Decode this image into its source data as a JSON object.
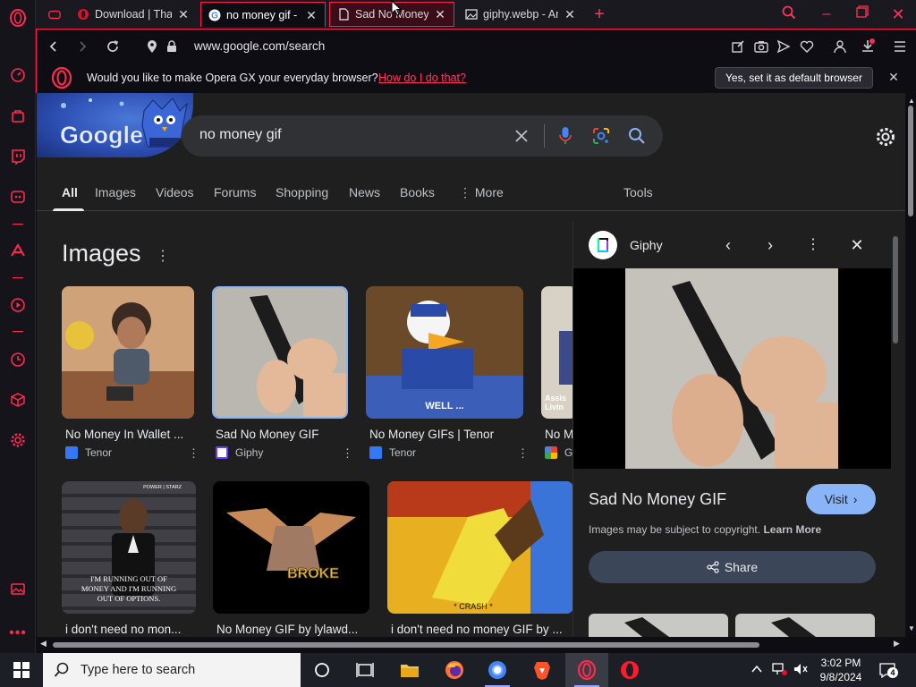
{
  "browser": {
    "tabs": [
      {
        "title": "Download | Thar",
        "favicon": "opera-icon",
        "active": false
      },
      {
        "title": "no money gif - G",
        "favicon": "google-icon",
        "active": true
      },
      {
        "title": "Sad No Money G",
        "favicon": "document-icon",
        "active": false
      },
      {
        "title": "giphy.webp - An",
        "favicon": "image-icon",
        "active": false
      }
    ],
    "url": "www.google.com/search",
    "banner": {
      "text": "Would you like to make Opera GX your everyday browser?",
      "link": "How do I do that?",
      "button": "Yes, set it as default browser"
    }
  },
  "search": {
    "query": "no money gif",
    "doodle_label": "Google"
  },
  "google_tabs": [
    {
      "label": "All",
      "active": true
    },
    {
      "label": "Images"
    },
    {
      "label": "Videos"
    },
    {
      "label": "Forums"
    },
    {
      "label": "Shopping"
    },
    {
      "label": "News"
    },
    {
      "label": "Books"
    },
    {
      "label": "More"
    },
    {
      "label": "Tools"
    }
  ],
  "images_section": {
    "heading": "Images",
    "results": [
      {
        "title": "No Money In Wallet ...",
        "source": "Tenor"
      },
      {
        "title": "Sad No Money GIF",
        "source": "Giphy"
      },
      {
        "title": "No Money GIFs | Tenor",
        "source": "Tenor"
      },
      {
        "title": "No M",
        "source": "G"
      },
      {
        "title": "i don't need no mon...",
        "source": ""
      },
      {
        "title": "No Money GIF by lylawd...",
        "source": ""
      },
      {
        "title": "i don't need no money GIF by ...",
        "source": ""
      }
    ],
    "thumb_captions": {
      "donald": "WELL ...",
      "assisted": "Assis\nLivin",
      "suit": "I'M RUNNING OUT OF MONEY AND I'M RUNNING OUT OF OPTIONS.",
      "suit_corner": "POWER | STARZ",
      "broke": "BROKE",
      "spongebob": "* CRASH *"
    }
  },
  "preview": {
    "source": "Giphy",
    "title": "Sad No Money GIF",
    "visit": "Visit",
    "copyright": "Images may be subject to copyright.",
    "learn_more": "Learn More",
    "share": "Share"
  },
  "taskbar": {
    "search_placeholder": "Type here to search",
    "time": "3:02 PM",
    "date": "9/8/2024",
    "notification_count": "4"
  },
  "colors": {
    "opera_red": "#ff1f4a",
    "google_bg": "#1f1f1f",
    "visit_blue": "#8ab4f8",
    "share_bg": "#3c4659"
  }
}
